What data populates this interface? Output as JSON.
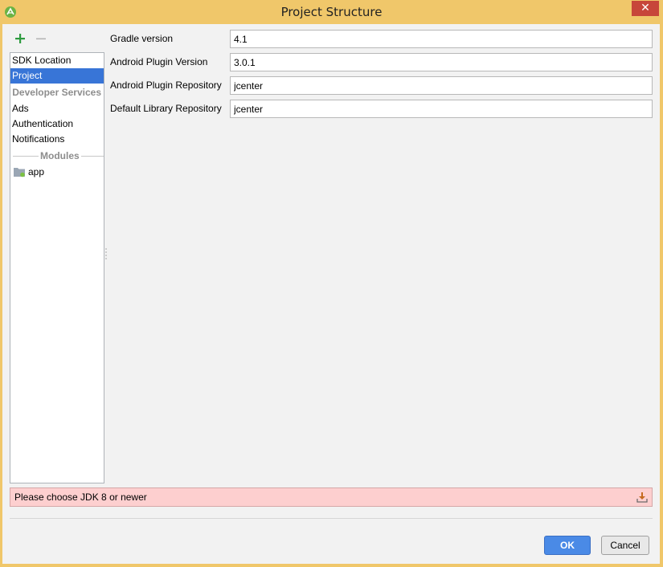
{
  "window": {
    "title": "Project Structure",
    "close_glyph": "✕"
  },
  "toolbar": {
    "add_icon": "plus-icon",
    "remove_icon": "minus-icon"
  },
  "sidebar": {
    "items": [
      {
        "label": "SDK Location"
      },
      {
        "label": "Project",
        "selected": true
      }
    ],
    "developer_services_header": "Developer Services",
    "developer_services_items": [
      {
        "label": "Ads"
      },
      {
        "label": "Authentication"
      },
      {
        "label": "Notifications"
      }
    ],
    "modules_header": "Modules",
    "modules": [
      {
        "label": "app"
      }
    ]
  },
  "form": {
    "gradle_version": {
      "label": "Gradle version",
      "value": "4.1"
    },
    "android_plugin_version": {
      "label": "Android Plugin Version",
      "value": "3.0.1"
    },
    "android_plugin_repository": {
      "label": "Android Plugin Repository",
      "value": "jcenter"
    },
    "default_library_repository": {
      "label": "Default Library Repository",
      "value": "jcenter"
    }
  },
  "error": {
    "message": "Please choose JDK 8 or newer"
  },
  "buttons": {
    "ok_label": "OK",
    "cancel_label": "Cancel"
  },
  "colors": {
    "title_bar": "#f0c76a",
    "selection": "#3875d7",
    "error_background": "#fdcfcf",
    "ok_button": "#4a8ae6",
    "add_icon": "#2e9b3f"
  }
}
